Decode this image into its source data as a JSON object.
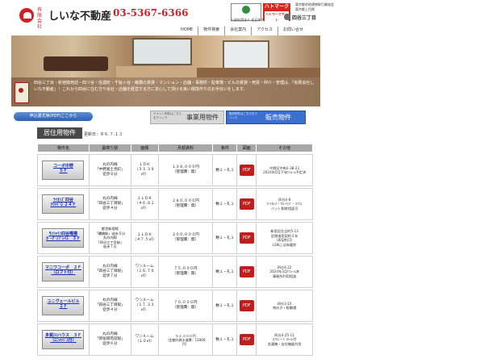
{
  "header": {
    "logo_small": "有限会社",
    "company_name": "しいな不動産",
    "phone": "03-5367-6366",
    "badge_caption": "公益社団法人 全日本不動産協会",
    "hatoma_label": "ハトマーク",
    "hatoma_sub": "ハトマークサイト",
    "association": "東京都宅地建物取引業協会",
    "association2": "東京都上目黒",
    "branch": "四谷三丁目"
  },
  "nav": {
    "items": [
      "HOME",
      "物件検索",
      "会社案内",
      "アクセス",
      "お問い合せ"
    ]
  },
  "info": {
    "text": "四谷三丁目・新宿御苑前・四ツ谷・信濃町・千駄ヶ谷・曙橋の賃貸・マンション・店舗・事務所・駐車場・ビルの賃貸・売買・仲介・管理は、「有限会社しいな不動産」！これから四谷に住む方や会社・店舗を経営する方に安心して頂ける良い環境作りのお手伝いをします。"
  },
  "buttons": {
    "pdf": "申込書式等(PDF)ここから",
    "business_small": "テナント物件はこちらをクリック",
    "business_big": "事業用物件",
    "sales_small": "販売物件はこちらをクリック",
    "sales_big": "販売物件"
  },
  "section": {
    "title": "居住用物件",
    "updated": "更新日：Ｒ６.７.１３"
  },
  "table": {
    "headers": [
      "物件名",
      "最寄り駅",
      "面積",
      "月額賃料",
      "条件",
      "図面",
      "その他"
    ],
    "pdf_label": "PDF",
    "rows": [
      {
        "name": "コーポ中野\n５Ｆ",
        "station": "丸の内線\n「中野富士見町」\n徒歩８分",
        "area": "１ＤＫ\n（３３.３９\n㎡）",
        "rent": "１３８,０００円\n（管理費：無）",
        "terms": "敷１・礼１",
        "other": "中野区中央2-38-21\n2024年5月下旬ﾘﾌｫｰﾑ予定済"
      },
      {
        "name": "ﾗｲｵﾝｽﾞ四谷\nｸﾜｯﾄﾞﾛ ２４Ｆ",
        "station": "丸の内線\n「四谷三丁目駅」\n徒歩４分",
        "area": "１ＬＤＫ\n（４６.８１\n㎡）",
        "rent": "２８０,０００円\n（管理費：無）",
        "terms": "敷１・礼１",
        "other": "四谷4-8\nｵｰﾄﾛｯｸ・ﾌﾛｰﾘﾝｸﾞ・ｴｱｺﾝ\nペット飼育相談可"
      },
      {
        "name": "ｻﾝｼｬｲﾝ四谷曙橋\nｶﾞｰﾃﾞﾝﾌﾟﾚｲｽ　３Ｆ",
        "station": "都営新宿線\n「曙橋駅」徒歩５分\n丸の内線\n「四谷三丁目駅」\n徒歩７分",
        "area": "１ＬＤＫ\n（４７.５㎡）",
        "rent": "２００,０００円\n（管理費：無）",
        "terms": "敷１・礼１",
        "other": "新宿区住吉町5-13\n定期借家契約３年\n（再契約可）\nLDKには床暖房"
      },
      {
        "name": "マニワコーポ　２Ｆ\n（ロフト付）",
        "station": "丸の内線\n「四谷三丁目駅」\n徒歩７分",
        "area": "ワンルーム\n（１６.７６\n㎡）",
        "rent": "７５,０００円\n（管理費：無）",
        "terms": "敷１・礼１",
        "other": "四谷4-22\n2024年3月ﾘﾌｫｰﾑ済\n事務所利用相談"
      },
      {
        "name": "ユニヴェールビル\n２Ｆ",
        "station": "丸の内線\n「四谷三丁目駅」\n徒歩４分",
        "area": "ワンルーム\n（１７.２３\n㎡）",
        "rent": "７０,０００円\n（管理費：無）",
        "terms": "敷１・礼１",
        "other": "四谷3-10\n南向き・駐輪場"
      },
      {
        "name": "多賀川ハウス　３Ｆ\n（ﾕﾆｯﾄﾊﾞｽ付）",
        "station": "丸の内線\n「新宿御苑前駅」\n徒歩６分",
        "area": "ワンルーム\n（１０㎡）",
        "rent": "５２,０００円\n（定額光熱水道費：11000\n円）",
        "terms": "敷１・礼１",
        "other": "四谷4-25-11\nｴｱｺﾝ・ﾊﾞｽﾄｲﾚ付\n洗濯機・自炊機器共用"
      }
    ]
  }
}
